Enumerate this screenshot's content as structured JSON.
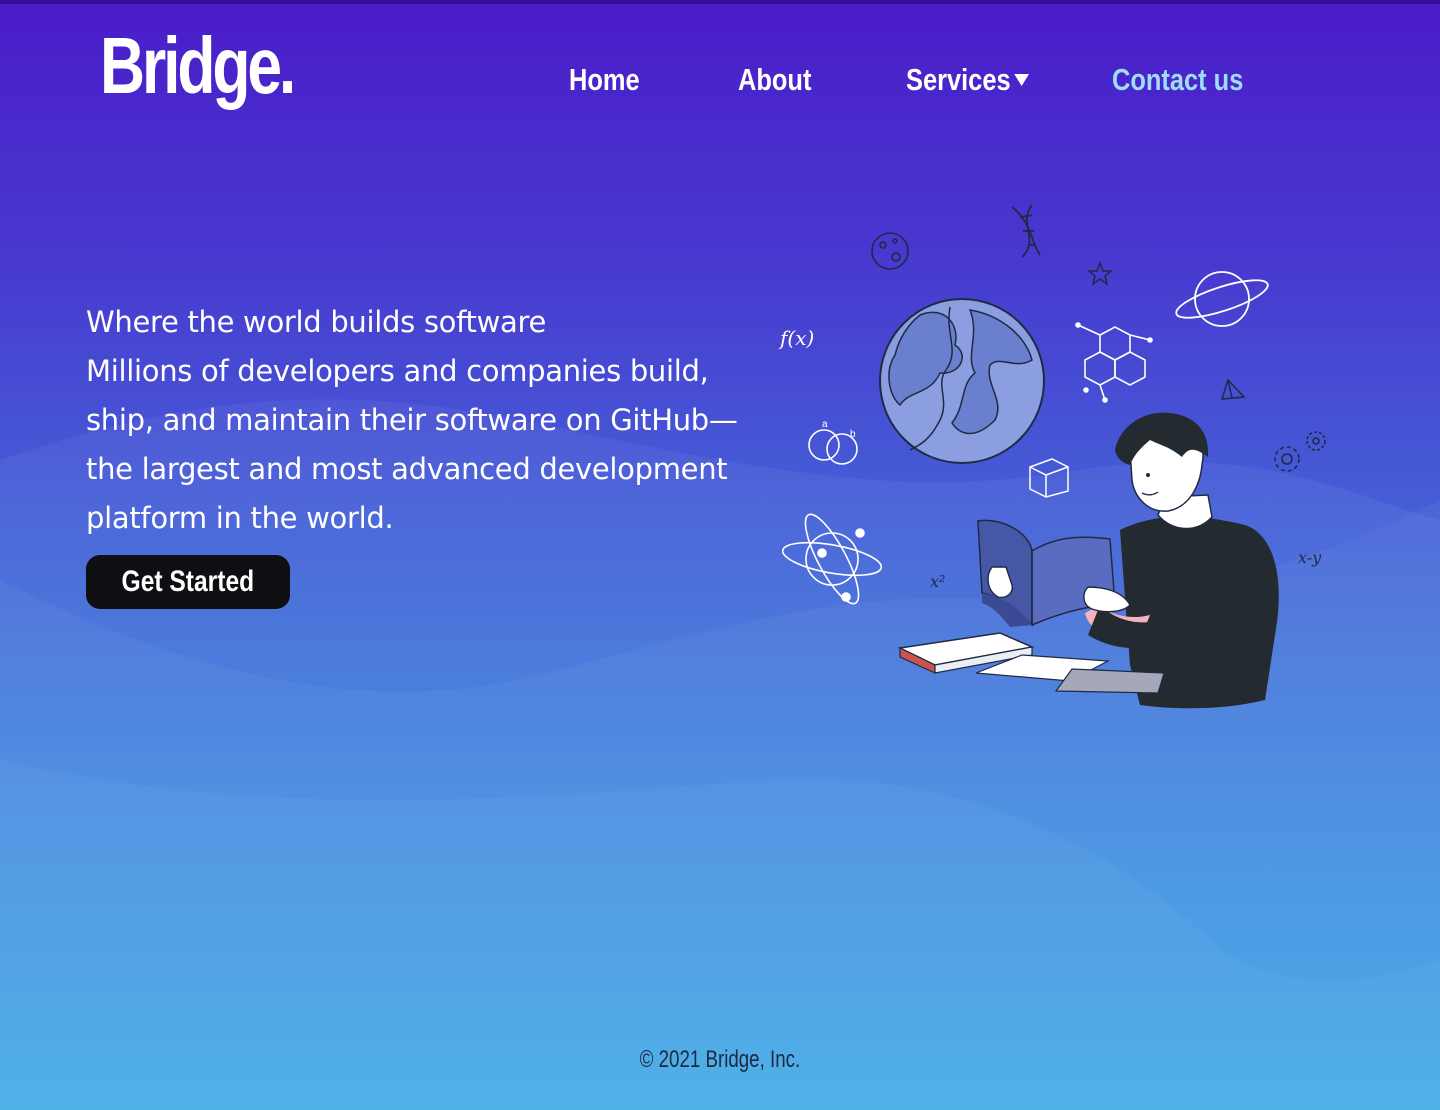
{
  "brand": {
    "logo_text": "Bridge."
  },
  "nav": {
    "items": [
      {
        "label": "Home"
      },
      {
        "label": "About"
      },
      {
        "label": "Services",
        "has_dropdown": true
      },
      {
        "label": "Contact us",
        "highlight": true
      }
    ]
  },
  "hero": {
    "heading": "Where the world builds software",
    "body": "Millions of developers and companies build, ship, and maintain their software on GitHub—the largest and most advanced development platform in the world.",
    "cta_label": "Get Started"
  },
  "illustration": {
    "icon": "reading-person-science-icon",
    "formula_fx": "f(x)",
    "formula_x2": "x²",
    "formula_xy": "x-y",
    "venn_a": "a",
    "venn_b": "b"
  },
  "footer": {
    "copyright": "© 2021 Bridge, Inc."
  },
  "colors": {
    "gradient_top": "#4a1cc9",
    "gradient_bottom": "#37a8e5",
    "contact_link": "#9fdcf8",
    "button_bg": "#0e0f12",
    "footer_text": "#1c2a40"
  }
}
